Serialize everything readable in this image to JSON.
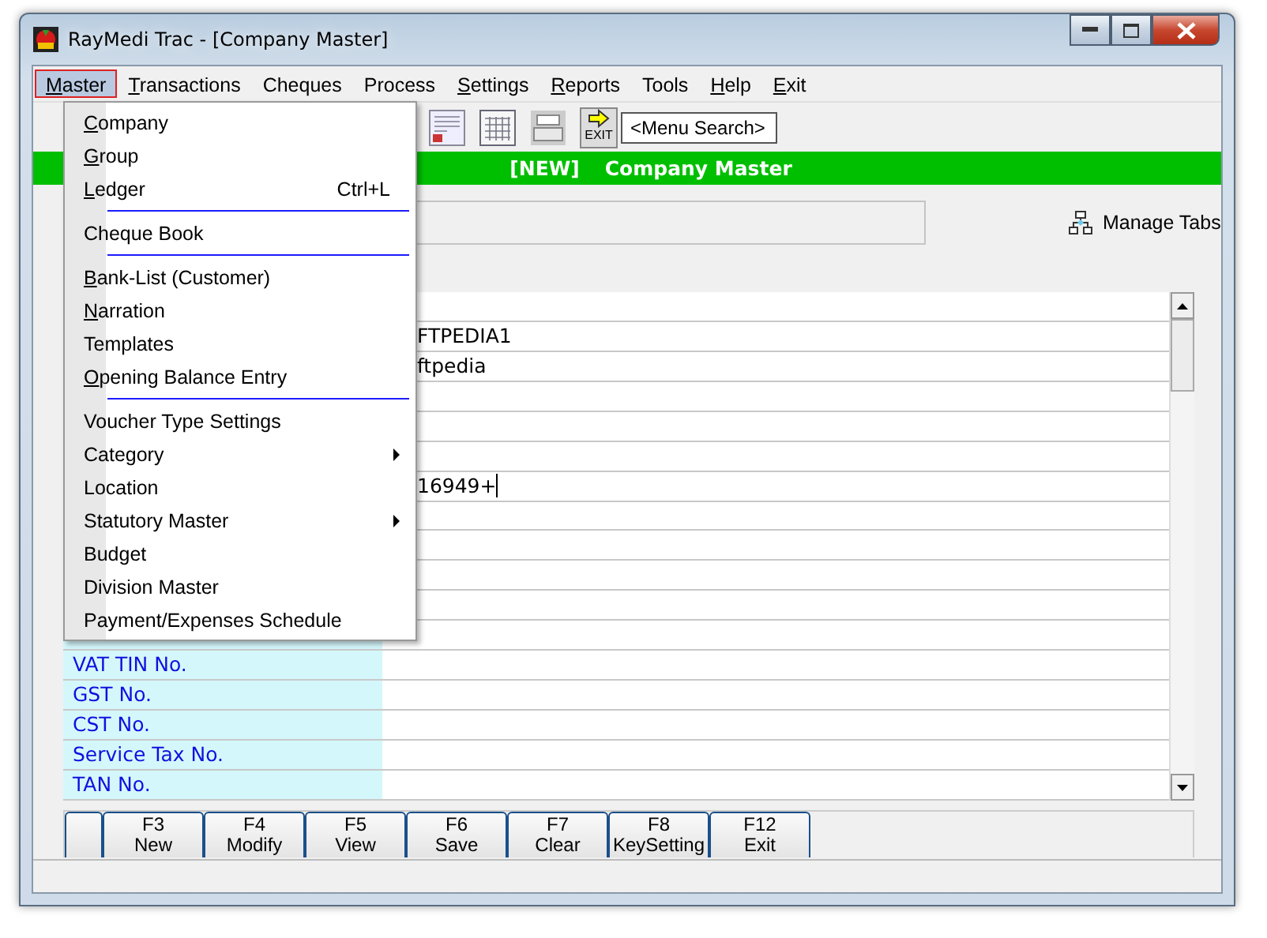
{
  "window": {
    "title": "RayMedi Trac - [Company Master]"
  },
  "menubar": [
    {
      "label": "Master",
      "selected": true,
      "underline_first": true
    },
    {
      "label": "Transactions",
      "selected": false,
      "underline_first": true
    },
    {
      "label": "Cheques",
      "selected": false,
      "underline_first": false
    },
    {
      "label": "Process",
      "selected": false,
      "underline_first": false
    },
    {
      "label": "Settings",
      "selected": false,
      "underline_first": true
    },
    {
      "label": "Reports",
      "selected": false,
      "underline_first": true
    },
    {
      "label": "Tools",
      "selected": false,
      "underline_first": false
    },
    {
      "label": "Help",
      "selected": false,
      "underline_first": true
    },
    {
      "label": "Exit",
      "selected": false,
      "underline_first": true
    }
  ],
  "dropdown": [
    {
      "kind": "item",
      "label": "Company",
      "underline_first": true
    },
    {
      "kind": "item",
      "label": "Group",
      "underline_first": true
    },
    {
      "kind": "item",
      "label": "Ledger",
      "underline_first": true,
      "shortcut": "Ctrl+L"
    },
    {
      "kind": "separator"
    },
    {
      "kind": "item",
      "label": "Cheque Book",
      "underline_first": false
    },
    {
      "kind": "separator"
    },
    {
      "kind": "item",
      "label": "Bank-List (Customer)",
      "underline_first": true
    },
    {
      "kind": "item",
      "label": "Narration",
      "underline_first": true
    },
    {
      "kind": "item",
      "label": "Templates",
      "underline_first": false
    },
    {
      "kind": "item",
      "label": "Opening Balance Entry",
      "underline_first": true
    },
    {
      "kind": "separator"
    },
    {
      "kind": "item",
      "label": "Voucher Type Settings",
      "underline_first": false
    },
    {
      "kind": "submenu",
      "label": "Category",
      "underline_first": false
    },
    {
      "kind": "item",
      "label": "Location",
      "underline_first": false
    },
    {
      "kind": "submenu",
      "label": "Statutory Master",
      "underline_first": false
    },
    {
      "kind": "item",
      "label": "Budget",
      "underline_first": false
    },
    {
      "kind": "item",
      "label": "Division Master",
      "underline_first": false
    },
    {
      "kind": "item",
      "label": "Payment/Expenses Schedule",
      "underline_first": false
    }
  ],
  "toolbar": {
    "exit_label": "EXIT",
    "menu_search": "<Menu Search>"
  },
  "header": {
    "badge": "[NEW]",
    "title": "Company Master"
  },
  "manage_tabs": "Manage Tabs",
  "grid_rows": [
    {},
    {
      "value": "FTPEDIA1"
    },
    {
      "value": "ftpedia"
    },
    {},
    {},
    {},
    {
      "value": "16949+",
      "focused": true
    },
    {},
    {},
    {},
    {},
    {},
    {
      "label": "VAT TIN No."
    },
    {
      "label": "GST No."
    },
    {
      "label": "CST No."
    },
    {
      "label": "Service Tax No."
    },
    {
      "label": "TAN No."
    }
  ],
  "function_keys": [
    {
      "key": "F3",
      "label": "New"
    },
    {
      "key": "F4",
      "label": "Modify"
    },
    {
      "key": "F5",
      "label": "View"
    },
    {
      "key": "F6",
      "label": "Save"
    },
    {
      "key": "F7",
      "label": "Clear"
    },
    {
      "key": "F8",
      "label": "KeySetting"
    },
    {
      "key": "F12",
      "label": "Exit"
    }
  ]
}
